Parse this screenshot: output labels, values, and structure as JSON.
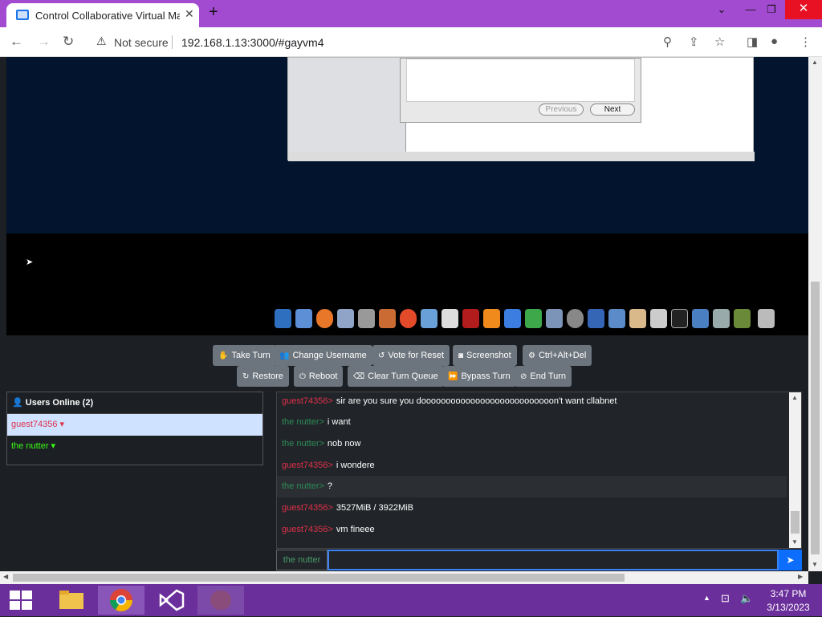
{
  "browser": {
    "tab_title": "Control Collaborative Virtual Mac",
    "not_secure": "Not secure",
    "url": "192.168.1.13:3000/#gayvm4"
  },
  "vm": {
    "dialog": {
      "previous_label": "Previous",
      "next_label": "Next"
    }
  },
  "toolbar": {
    "take_turn": "Take Turn",
    "change_username": "Change Username",
    "vote_reset": "Vote for Reset",
    "screenshot": "Screenshot",
    "ctrl_alt_del": "Ctrl+Alt+Del",
    "restore": "Restore",
    "reboot": "Reboot",
    "clear_queue": "Clear Turn Queue",
    "bypass_turn": "Bypass Turn",
    "end_turn": "End Turn"
  },
  "users": {
    "header": "Users Online (2)",
    "list": [
      {
        "name": "guest74356 ▾",
        "color": "#e0304a"
      },
      {
        "name": "the nutter ▾",
        "color": "#39ff14"
      }
    ]
  },
  "chat": {
    "messages": [
      {
        "user": "guest74356>",
        "text": "sir are you sure you dooooooooooooooooooooooooooon't want cllabnet",
        "color": "#e0304a"
      },
      {
        "user": "the nutter>",
        "text": "i want",
        "color": "#2e8b57"
      },
      {
        "user": "the nutter>",
        "text": "nob now",
        "color": "#2e8b57"
      },
      {
        "user": "guest74356>",
        "text": "i wondere",
        "color": "#e0304a"
      },
      {
        "user": "the nutter>",
        "text": "?",
        "color": "#2e8b57"
      },
      {
        "user": "guest74356>",
        "text": "3527MiB / 3922MiB",
        "color": "#e0304a"
      },
      {
        "user": "guest74356>",
        "text": "vm fineee",
        "color": "#e0304a"
      }
    ],
    "input_username": "the nutter",
    "input_value": ""
  },
  "taskbar": {
    "time": "3:47 PM",
    "date": "3/13/2023"
  }
}
